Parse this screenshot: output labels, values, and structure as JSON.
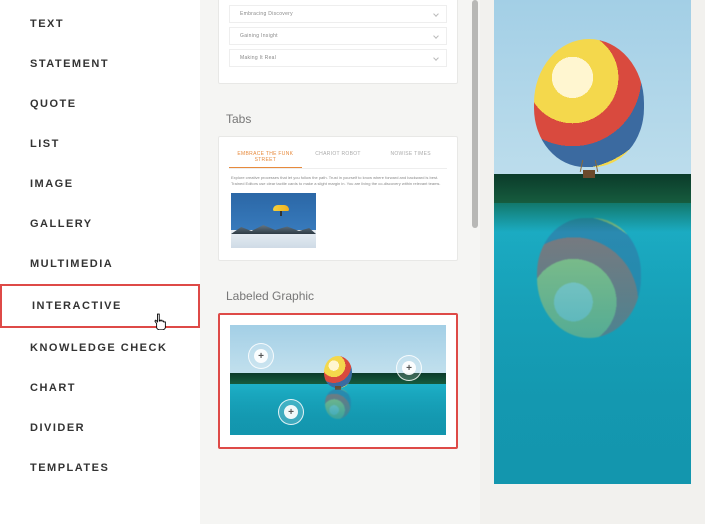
{
  "sidebar": {
    "items": [
      {
        "label": "TEXT"
      },
      {
        "label": "STATEMENT"
      },
      {
        "label": "QUOTE"
      },
      {
        "label": "LIST"
      },
      {
        "label": "IMAGE"
      },
      {
        "label": "GALLERY"
      },
      {
        "label": "MULTIMEDIA"
      },
      {
        "label": "INTERACTIVE",
        "selected": true
      },
      {
        "label": "KNOWLEDGE CHECK"
      },
      {
        "label": "CHART"
      },
      {
        "label": "DIVIDER"
      },
      {
        "label": "TEMPLATES"
      }
    ]
  },
  "blocks": {
    "accordion_items": [
      "Embracing Discovery",
      "Gaining Insight",
      "Making It Real"
    ],
    "tabs_label": "Tabs",
    "tabs": {
      "tab_labels": [
        "EMBRACE THE FUNK STREET",
        "CHARIOT ROBOT",
        "NOWISE TIMES"
      ],
      "active_tab_index": 0,
      "body_text": "Explore creative processes that let you follow the path. Trust in yourself to know where forward and backward is best. Trained Editors use clear tactile cards to make a slight margin in. You are living the co-discovery within relevant teams."
    },
    "labeled_graphic_label": "Labeled Graphic"
  }
}
